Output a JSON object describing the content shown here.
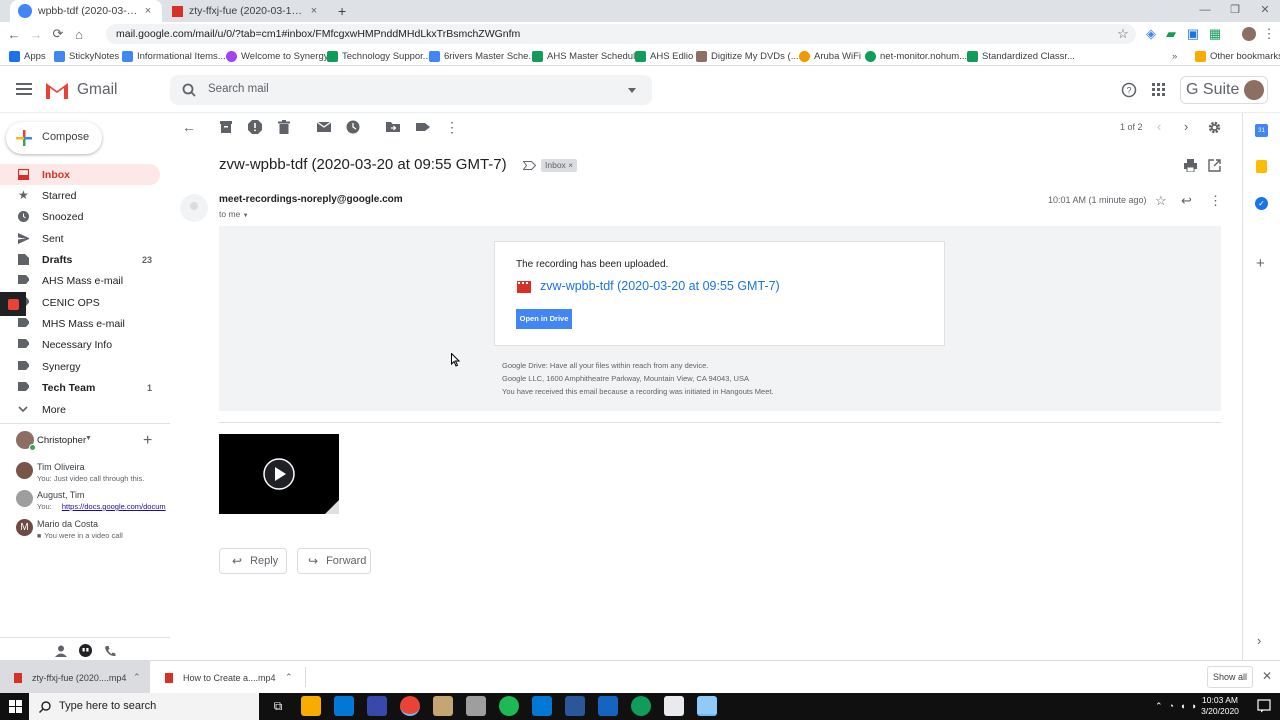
{
  "browser": {
    "tabs": [
      {
        "title": "wpbb-tdf (2020-03-20 at 09:",
        "close": "×",
        "active": true
      },
      {
        "title": "zty-ffxj-fue (2020-03-19 at 16:0",
        "close": "×",
        "active": false
      }
    ],
    "new_tab": "+",
    "url": "mail.google.com/mail/u/0/?tab=cm1#inbox/FMfcgxwHMPnddMHdLkxTrBsmchZWGnfm",
    "bookmarks": [
      {
        "label": "Apps",
        "color": "#1a73e8"
      },
      {
        "label": "StickyNotes",
        "color": "#4285f4"
      },
      {
        "label": "Informational Items...",
        "color": "#4285f4"
      },
      {
        "label": "Welcome to Synergy!",
        "color": "#a142f4"
      },
      {
        "label": "Technology Suppor...",
        "color": "#0f9d58"
      },
      {
        "label": "6rivers Master Sche...",
        "color": "#4285f4"
      },
      {
        "label": "AHS Master Schedule",
        "color": "#0f9d58"
      },
      {
        "label": "AHS Edlio",
        "color": "#0f9d58"
      },
      {
        "label": "Digitize My DVDs (...",
        "color": "#8d6e63"
      },
      {
        "label": "Aruba WiFi",
        "color": "#5f6368"
      },
      {
        "label": "net-monitor.nohum...",
        "color": "#f29900"
      },
      {
        "label": "Standardized Classr...",
        "color": "#0f9d58"
      },
      {
        "label": "Other bookmarks",
        "color": "#f9ab00"
      }
    ]
  },
  "gmail": {
    "logo_text": "Gmail",
    "search_placeholder": "Search mail",
    "gsuite": "G Suite",
    "compose": "Compose",
    "nav": [
      {
        "label": "Inbox",
        "count": "",
        "selected": true
      },
      {
        "label": "Starred",
        "count": ""
      },
      {
        "label": "Snoozed",
        "count": ""
      },
      {
        "label": "Sent",
        "count": ""
      },
      {
        "label": "Drafts",
        "count": "23",
        "bold": true
      },
      {
        "label": "AHS Mass e-mail",
        "count": ""
      },
      {
        "label": "CENIC OPS",
        "count": ""
      },
      {
        "label": "MHS Mass e-mail",
        "count": ""
      },
      {
        "label": "Necessary Info",
        "count": ""
      },
      {
        "label": "Synergy",
        "count": ""
      },
      {
        "label": "Tech Team",
        "count": "1",
        "bold": true
      },
      {
        "label": "More",
        "count": ""
      }
    ],
    "chat_user": "Christopher",
    "chats": [
      {
        "name": "Tim Oliveira",
        "snippet": "You: Just video call through this."
      },
      {
        "name": "August, Tim",
        "snippet": "You:",
        "link": "https://docs.google.com/docum"
      },
      {
        "name": "Mario da Costa",
        "snippet": "You were in a video call",
        "initial": "M"
      }
    ],
    "pagination": "1 of 2",
    "email": {
      "subject": "zvw-wpbb-tdf (2020-03-20 at 09:55 GMT-7)",
      "label": "Inbox",
      "label_x": "×",
      "sender": "meet-recordings-noreply@google.com",
      "to": "to me",
      "time": "10:01 AM (1 minute ago)",
      "uploaded": "The recording has been uploaded.",
      "file_link": "zvw-wpbb-tdf (2020-03-20 at 09:55 GMT-7)",
      "open_drive": "Open in Drive",
      "footer": [
        "Google Drive: Have all your files within reach from any device.",
        "Google LLC, 1600 Amphitheatre Parkway, Mountain View, CA 94043, USA",
        "You have received this email because a recording was initiated in Hangouts Meet."
      ],
      "reply": "Reply",
      "forward": "Forward"
    }
  },
  "downloads": {
    "items": [
      "zty-ffxj-fue (2020....mp4",
      "How to Create a....mp4"
    ],
    "show_all": "Show all"
  },
  "taskbar": {
    "search_placeholder": "Type here to search",
    "time": "10:03 AM",
    "date": "3/20/2020"
  }
}
